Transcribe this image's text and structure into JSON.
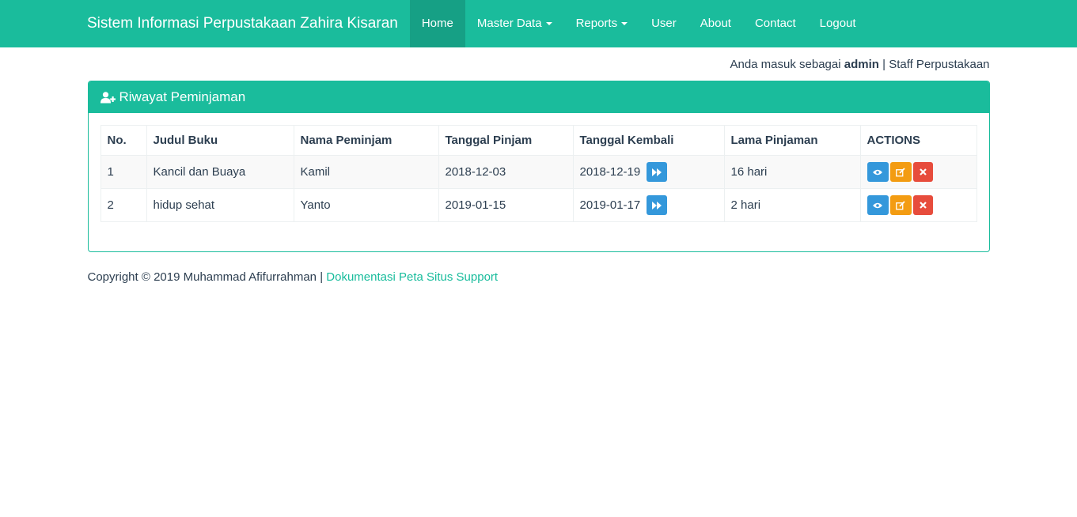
{
  "navbar": {
    "brand": "Sistem Informasi Perpustakaan Zahira Kisaran",
    "items": [
      {
        "label": "Home",
        "active": true
      },
      {
        "label": "Master Data",
        "dropdown": true
      },
      {
        "label": "Reports",
        "dropdown": true
      },
      {
        "label": "User"
      },
      {
        "label": "About"
      },
      {
        "label": "Contact"
      },
      {
        "label": "Logout"
      }
    ]
  },
  "login_info": {
    "prefix": "Anda masuk sebagai",
    "username": "admin",
    "separator": "|",
    "role": "Staff Perpustakaan"
  },
  "panel": {
    "icon": "user-plus-icon",
    "title": "Riwayat Peminjaman"
  },
  "table": {
    "headers": [
      "No.",
      "Judul Buku",
      "Nama Peminjam",
      "Tanggal Pinjam",
      "Tanggal Kembali",
      "Lama Pinjaman",
      "ACTIONS"
    ],
    "rows": [
      {
        "no": "1",
        "judul": "Kancil dan Buaya",
        "peminjam": "Kamil",
        "tgl_pinjam": "2018-12-03",
        "tgl_kembali": "2018-12-19",
        "lama": "16 hari"
      },
      {
        "no": "2",
        "judul": "hidup sehat",
        "peminjam": "Yanto",
        "tgl_pinjam": "2019-01-15",
        "tgl_kembali": "2019-01-17",
        "lama": "2 hari"
      }
    ]
  },
  "footer": {
    "copyright": "Copyright © 2019 Muhammad Afifurrahman |",
    "links": [
      "Dokumentasi",
      "Peta Situs",
      "Support"
    ]
  },
  "colors": {
    "primary": "#1abc9c",
    "primary_dark": "#16a085",
    "info": "#3498db",
    "warning": "#f39c12",
    "danger": "#e74c3c"
  }
}
